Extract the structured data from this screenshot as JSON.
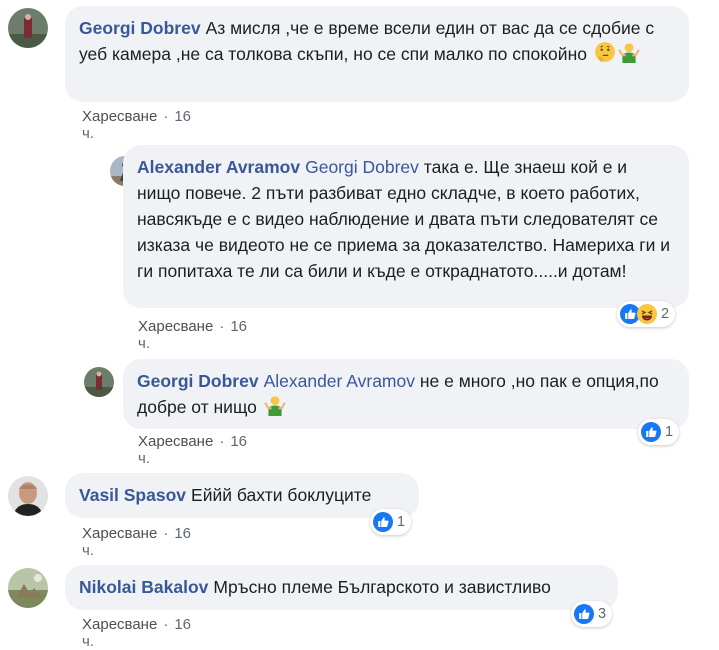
{
  "comments": [
    {
      "author": "Georgi Dobrev",
      "mention": "",
      "text": "Аз мисля ,че е време всели един от вас да се сдобие с уеб камера ,не са толкова скъпи, но се спи малко по спокойно",
      "like_label": "Харесване",
      "separator": "·",
      "time": "16 ч.",
      "reaction_count": ""
    },
    {
      "author": "Alexander Avramov",
      "mention": "Georgi Dobrev",
      "text": "така е. Ще знаеш кой е и нищо повече. 2 пъти разбиват едно складче, в което работих, навсякъде е с видео наблюдение и двата пъти следователят се изказа че видеото не се приема за доказателство. Намериха ги и ги попитаха те ли са били и къде е откраднатото.....и дотам!",
      "like_label": "Харесване",
      "separator": "·",
      "time": "16 ч.",
      "reaction_count": "2"
    },
    {
      "author": "Georgi Dobrev",
      "mention": "Alexander Avramov",
      "text": "не е много ,но пак е опция,по добре от нищо",
      "like_label": "Харесване",
      "separator": "·",
      "time": "16 ч.",
      "reaction_count": "1"
    },
    {
      "author": "Vasil Spasov",
      "mention": "",
      "text": "Еййй бахти боклуците",
      "like_label": "Харесване",
      "separator": "·",
      "time": "16 ч.",
      "reaction_count": "1"
    },
    {
      "author": "Nikolai Bakalov",
      "mention": "",
      "text": "Мръсно племе Българското и завистливо",
      "like_label": "Харесване",
      "separator": "·",
      "time": "16 ч.",
      "reaction_count": "3"
    }
  ],
  "icons": {
    "like_reaction": "thumbs-up-icon",
    "haha_reaction": "laughing-face-icon",
    "thinking_emoji": "thinking-face-icon",
    "shrug_emoji": "person-shrugging-icon"
  },
  "colors": {
    "link": "#385898",
    "bubble": "#f0f2f5",
    "like_blue": "#1877f2",
    "meta": "#606770"
  }
}
